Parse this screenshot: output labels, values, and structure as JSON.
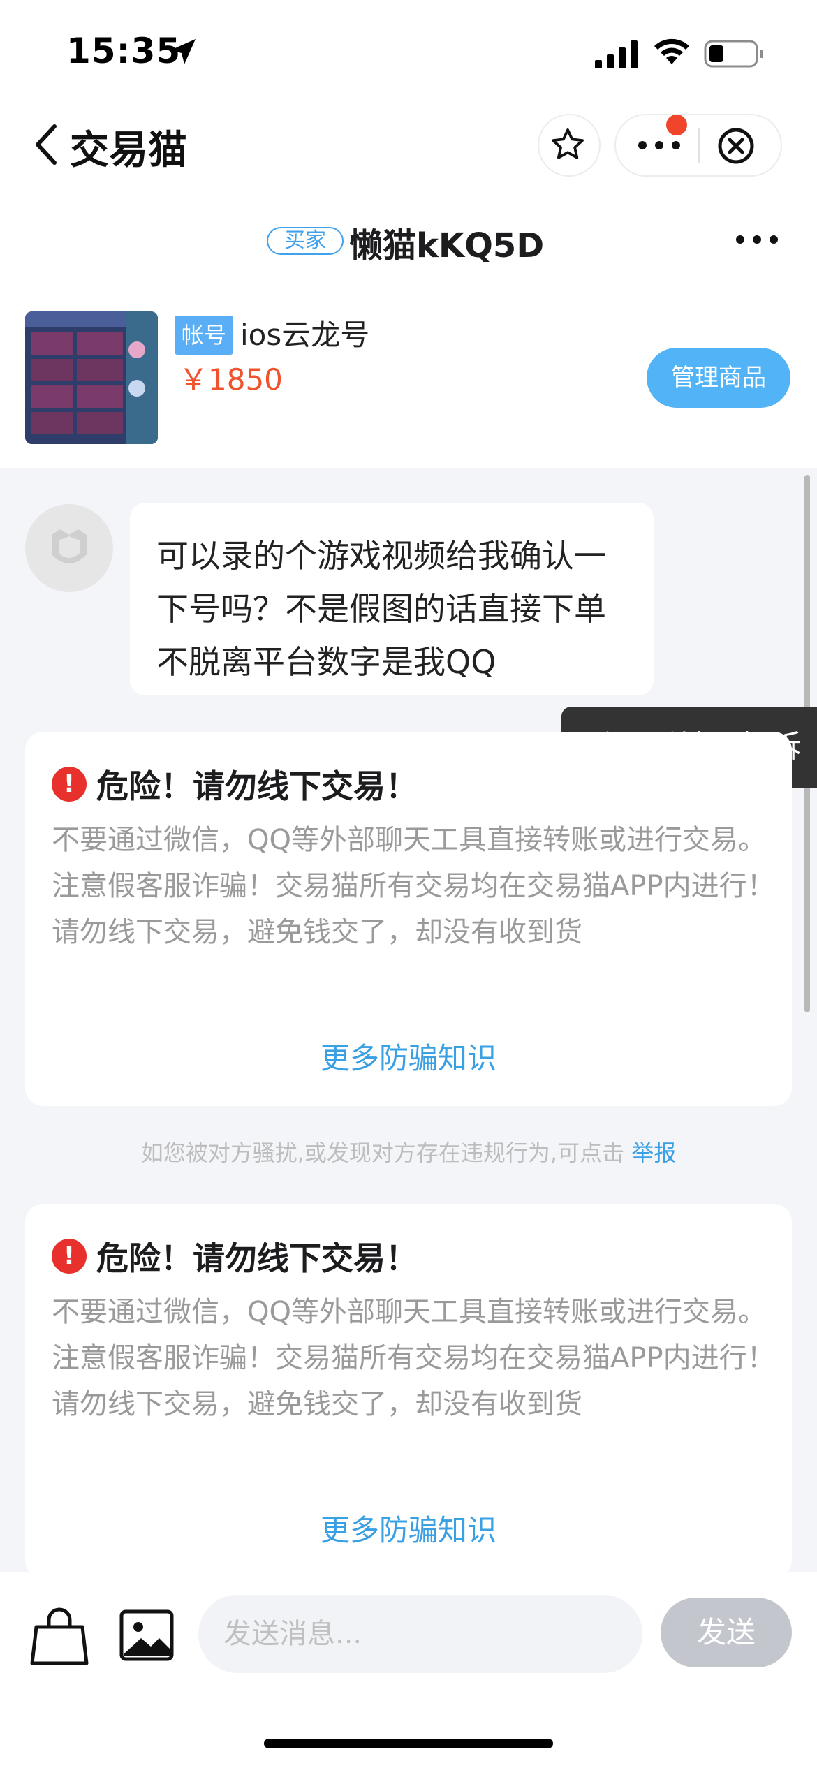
{
  "status_bar": {
    "time": "15:35"
  },
  "nav": {
    "title": "交易猫"
  },
  "chat_header": {
    "role_badge": "买家",
    "username": "懒猫kKQ5D"
  },
  "product": {
    "tag": "帐号",
    "name": "ios云龙号",
    "price": "￥1850",
    "manage_label": "管理商品"
  },
  "messages": [
    {
      "text": "可以录的个游戏视频给我确认一下号吗？不是假图的话直接下单 不脱离平台数字是我QQ"
    }
  ],
  "feedback": {
    "label": "反馈与投诉"
  },
  "warnings": [
    {
      "icon": "!",
      "title": "危险！请勿线下交易！",
      "body": "不要通过微信，QQ等外部聊天工具直接转账或进行交易。注意假客服诈骗！交易猫所有交易均在交易猫APP内进行！\n请勿线下交易，避免钱交了，却没有收到货",
      "link": "更多防骗知识"
    },
    {
      "icon": "!",
      "title": "危险！请勿线下交易！",
      "body": "不要通过微信，QQ等外部聊天工具直接转账或进行交易。注意假客服诈骗！交易猫所有交易均在交易猫APP内进行！\n请勿线下交易，避免钱交了，却没有收到货",
      "link": "更多防骗知识"
    }
  ],
  "report_note": {
    "text": "如您被对方骚扰,或发现对方存在违规行为,可点击",
    "link": "举报"
  },
  "input": {
    "placeholder": "发送消息...",
    "send_label": "发送"
  },
  "colors": {
    "accent": "#3aa0e4",
    "price": "#f0532d",
    "danger": "#e8312c",
    "manage_button": "#52b3f7",
    "send_button_disabled": "#c3c6cc"
  }
}
